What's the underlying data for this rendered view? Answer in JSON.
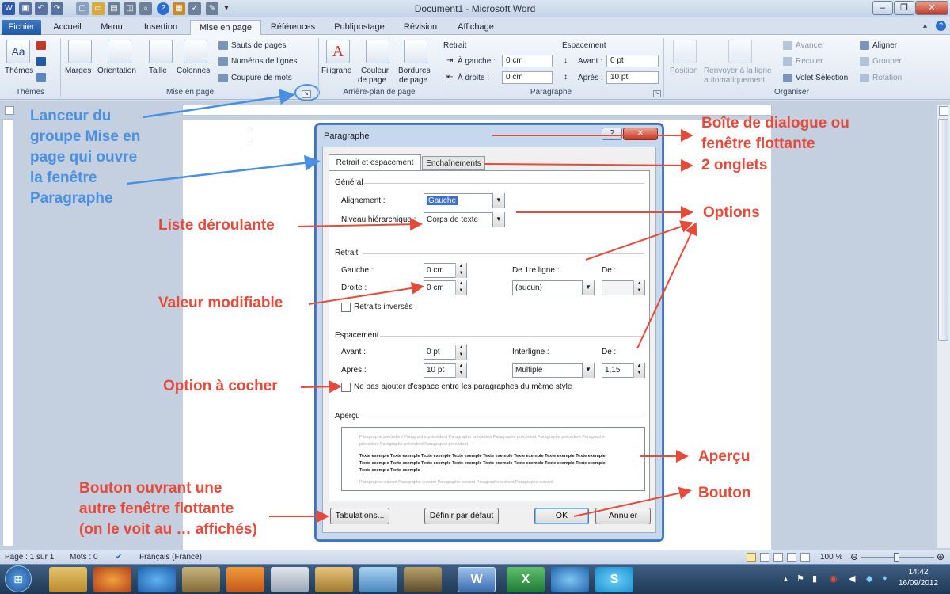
{
  "window": {
    "title": "Document1 - Microsoft Word"
  },
  "ribbon_tabs": [
    "Fichier",
    "Accueil",
    "Menu",
    "Insertion",
    "Mise en page",
    "Références",
    "Publipostage",
    "Révision",
    "Affichage"
  ],
  "ribbon": {
    "themes": "Thèmes",
    "marges": "Marges",
    "orientation": "Orientation",
    "taille": "Taille",
    "colonnes": "Colonnes",
    "sauts": "Sauts de pages",
    "numeros": "Numéros de lignes",
    "coupure": "Coupure de mots",
    "filigrane": "Filigrane",
    "couleur_l1": "Couleur",
    "couleur_l2": "de page",
    "bordures_l1": "Bordures",
    "bordures_l2": "de page",
    "retrait_title": "Retrait",
    "gauche_lbl": "À gauche :",
    "gauche_val": "0 cm",
    "droite_lbl": "À droite :",
    "droite_val": "0 cm",
    "espacement_title": "Espacement",
    "avant_lbl": "Avant :",
    "avant_val": "0 pt",
    "apres_lbl": "Après :",
    "apres_val": "10 pt",
    "position": "Position",
    "renvoyer_l1": "Renvoyer à la ligne",
    "renvoyer_l2": "automatiquement",
    "avancer": "Avancer",
    "reculer": "Reculer",
    "volet": "Volet Sélection",
    "aligner": "Aligner",
    "grouper": "Grouper",
    "rotation": "Rotation",
    "g_themes": "Thèmes",
    "g_mise": "Mise en page",
    "g_arriere": "Arrière-plan de page",
    "g_paragraphe": "Paragraphe",
    "g_organiser": "Organiser"
  },
  "dialog": {
    "title": "Paragraphe",
    "tab1": "Retrait et espacement",
    "tab2": "Enchaînements",
    "general": "Général",
    "alignement_lbl": "Alignement :",
    "alignement_val": "Gauche",
    "niveau_lbl": "Niveau hiérarchique :",
    "niveau_val": "Corps de texte",
    "retrait": "Retrait",
    "gauche_lbl": "Gauche :",
    "gauche_val": "0 cm",
    "droite_lbl": "Droite :",
    "droite_val": "0 cm",
    "premiere_lbl": "De 1re ligne :",
    "premiere_val": "(aucun)",
    "de_lbl": "De :",
    "inverses": "Retraits inversés",
    "espacement": "Espacement",
    "avant_lbl": "Avant :",
    "avant_val": "0 pt",
    "apres_lbl": "Après :",
    "apres_val": "10 pt",
    "interligne_lbl": "Interligne :",
    "interligne_val": "Multiple",
    "de2_lbl": "De :",
    "de2_val": "1,15",
    "nepas": "Ne pas ajouter d'espace entre les paragraphes du même style",
    "apercu": "Aperçu",
    "prev1": "Paragraphe précédent Paragraphe précédent Paragraphe précédent Paragraphe précédent Paragraphe précédent Paragraphe",
    "prev2": "précédent Paragraphe précédent Paragraphe précédent",
    "ex1": "Texte exemple Texte exemple Texte exemple Texte exemple Texte exemple Texte exemple Texte exemple Texte exemple",
    "ex2": "Texte exemple Texte exemple Texte exemple Texte exemple Texte exemple Texte exemple Texte exemple Texte exemple",
    "ex3": "Texte exemple Texte exemple",
    "next1": "Paragraphe suivant Paragraphe suivant Paragraphe suivant Paragraphe suivant Paragraphe suivant",
    "tabulations": "Tabulations...",
    "definir": "Définir par défaut",
    "ok": "OK",
    "annuler": "Annuler"
  },
  "annotations": {
    "lanceur": [
      "Lanceur du",
      "groupe Mise en",
      "page qui ouvre",
      "la fenêtre",
      "Paragraphe"
    ],
    "boite": [
      "Boîte de dialogue ou",
      "fenêtre flottante"
    ],
    "onglets": "2 onglets",
    "options": "Options",
    "liste": "Liste déroulante",
    "valeur": "Valeur modifiable",
    "option_cocher": "Option à cocher",
    "apercu": "Aperçu",
    "bouton": "Bouton",
    "bouton_ouvrant": [
      "Bouton ouvrant une",
      "autre fenêtre flottante",
      "(on le voit au … affichés)"
    ]
  },
  "status": {
    "page": "Page : 1 sur 1",
    "mots": "Mots : 0",
    "langue": "Français (France)",
    "zoom": "100 %"
  },
  "clock": {
    "time": "14:42",
    "date": "16/09/2012"
  },
  "colors": {
    "annotation_red": "#e64a3b",
    "annotation_blue": "#4a90e2",
    "dialog_border": "#3b74c9"
  }
}
